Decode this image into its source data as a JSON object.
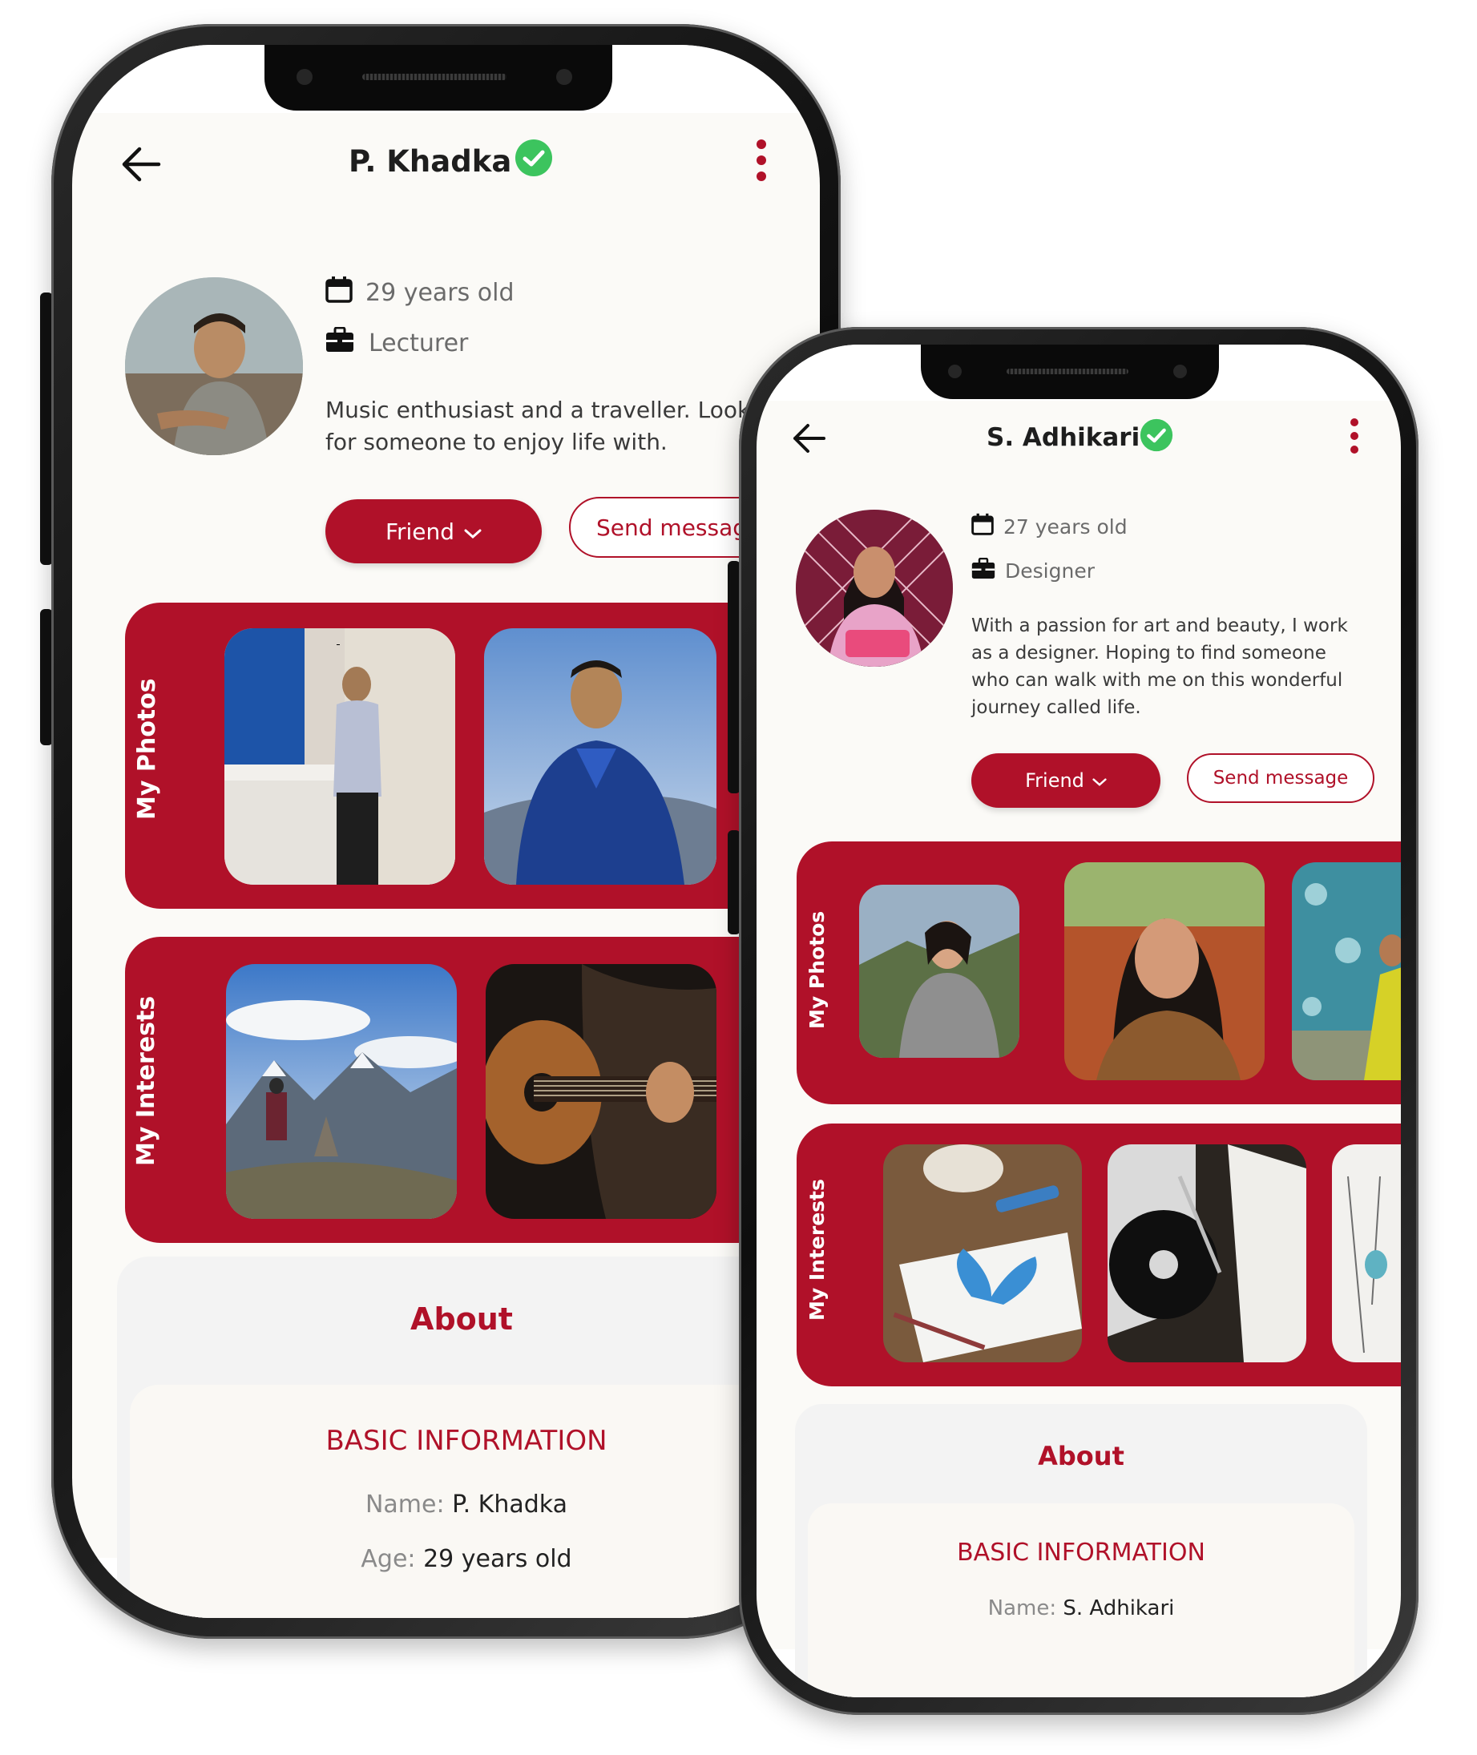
{
  "colors": {
    "accent": "#b01129",
    "verified": "#3cc45e",
    "background": "#fbfaf7"
  },
  "phone1": {
    "title": "P. Khadka",
    "age": "29 years old",
    "job": "Lecturer",
    "bio_line1": "Music enthusiast and a traveller. Look",
    "bio_line2": "for someone to enjoy life with.",
    "friend_label": "Friend",
    "message_label": "Send messag",
    "photos_label": "My Photos",
    "interests_label": "My Interests",
    "about_title": "About",
    "basic_title": "BASIC INFORMATION",
    "name_key": "Name:",
    "name_val": "P. Khadka",
    "age_key": "Age:",
    "age_val": "29 years old"
  },
  "phone2": {
    "title": "S. Adhikari",
    "age": "27 years old",
    "job": "Designer",
    "bio_line1": "With a passion for art and beauty, I work",
    "bio_line2": "as a designer. Hoping to find someone",
    "bio_line3": "who can walk with me on this wonderful",
    "bio_line4": "journey called life.",
    "friend_label": "Friend",
    "message_label": "Send message",
    "photos_label": "My Photos",
    "interests_label": "My Interests",
    "about_title": "About",
    "basic_title": "BASIC INFORMATION",
    "name_key": "Name:",
    "name_val": "S. Adhikari"
  },
  "icons": [
    "back-arrow-icon",
    "verified-check-icon",
    "more-vertical-icon",
    "calendar-icon",
    "briefcase-icon",
    "chevron-down-icon"
  ]
}
